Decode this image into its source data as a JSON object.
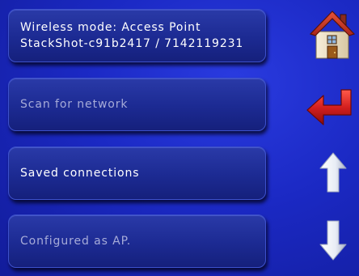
{
  "status": {
    "line1": "Wireless mode: Access Point",
    "line2": "StackShot-c91b2417 / 7142119231"
  },
  "buttons": {
    "scan_label": "Scan for network",
    "saved_label": "Saved connections",
    "config_label": "Configured as AP."
  },
  "icons": {
    "home": "home-icon",
    "back": "return-arrow-icon",
    "up": "arrow-up-icon",
    "down": "arrow-down-icon"
  },
  "colors": {
    "background": "#1b29c4",
    "button": "#1c2a92",
    "text_active": "#ffffff",
    "text_disabled": "#a6abd8",
    "accent_red": "#d41f1f"
  }
}
